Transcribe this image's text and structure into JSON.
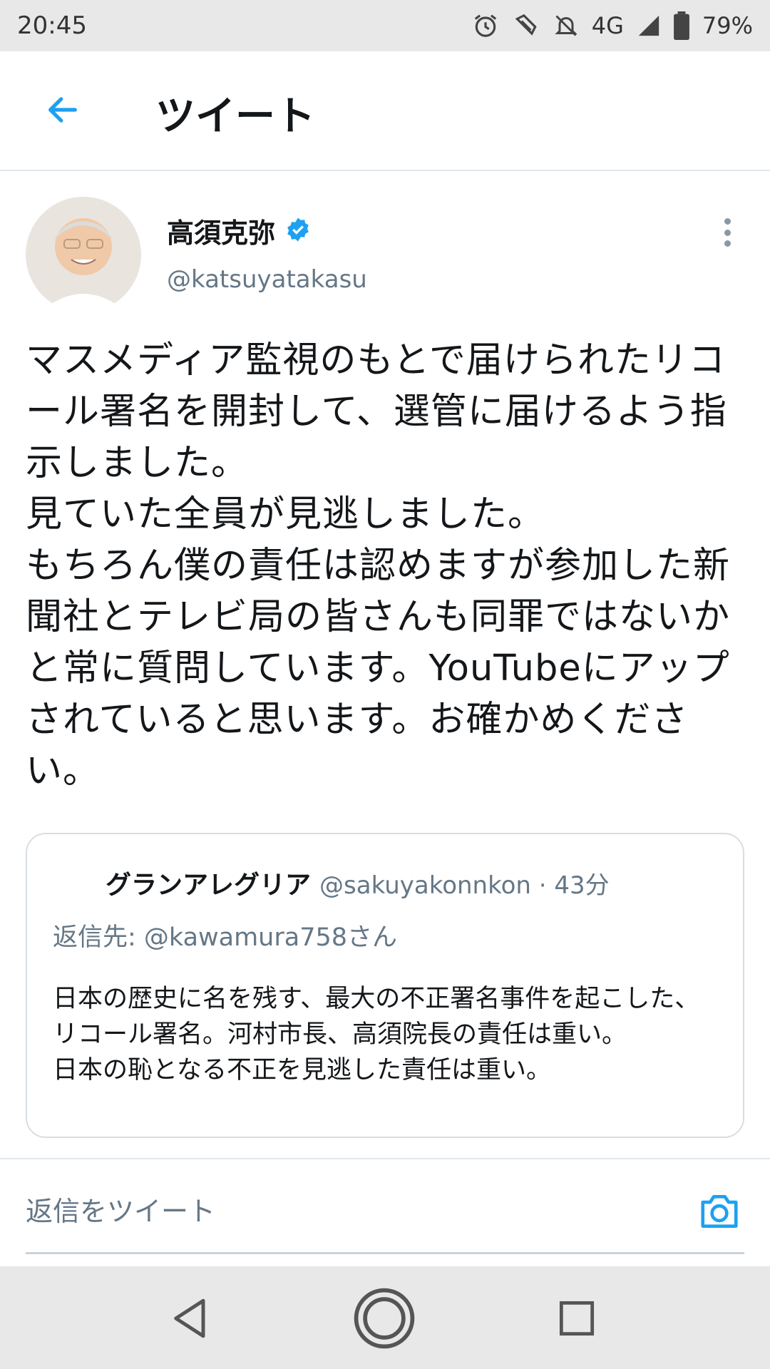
{
  "status_bar": {
    "time": "20:45",
    "network": "4G",
    "battery": "79%",
    "icons": [
      "alarm-icon",
      "nfc-icon",
      "mute-icon",
      "signal-icon",
      "battery-icon"
    ]
  },
  "header": {
    "title": "ツイート",
    "back_icon": "arrow-left-icon"
  },
  "tweet": {
    "author_name": "高須克弥",
    "verified": true,
    "handle": "@katsuyatakasu",
    "text": "マスメディア監視のもとで届けられたリコール署名を開封して、選管に届けるよう指示しました。\n見ていた全員が見逃しました。\nもちろん僕の責任は認めますが参加した新聞社とテレビ局の皆さんも同罪ではないかと常に質問しています。YouTubeにアップされていると思います。お確かめください。"
  },
  "quoted_tweet": {
    "author_name": "グランアレグリア",
    "meta": "@sakuyakonnkon · 43分",
    "reply_to": "返信先: @kawamura758さん",
    "text": "日本の歴史に名を残す、最大の不正署名事件を起こした、\nリコール署名。河村市長、高須院長の責任は重い。\n日本の恥となる不正を見逃した責任は重い。"
  },
  "reply": {
    "placeholder": "返信をツイート"
  },
  "colors": {
    "accent": "#1da1f2",
    "secondary_text": "#657786",
    "border": "#e1e8ed"
  }
}
